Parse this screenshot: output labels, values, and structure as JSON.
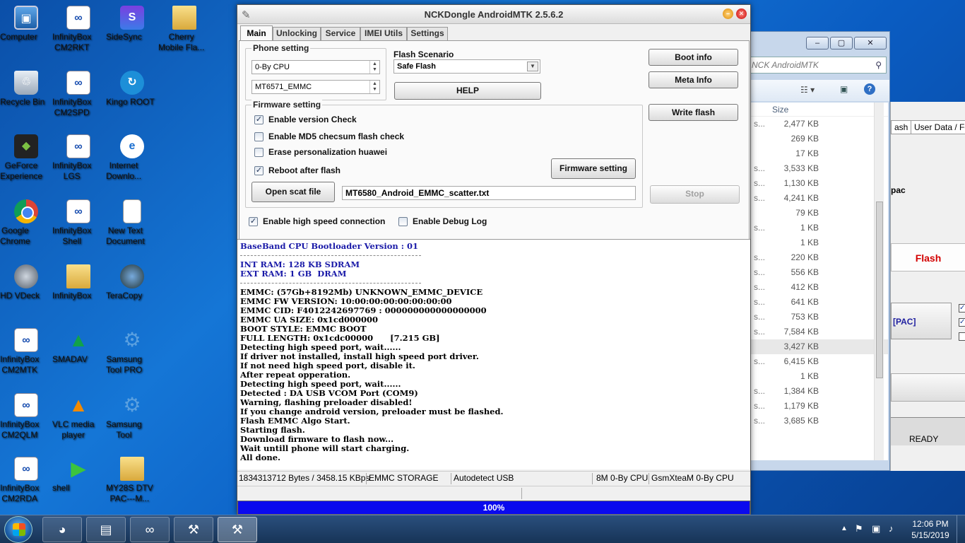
{
  "desktop": {
    "icons": [
      {
        "label": "Computer",
        "glyph": "▣",
        "cls": "computer"
      },
      {
        "label": "InfinityBox\nCM2RKT",
        "glyph": "∞",
        "cls": "infinity"
      },
      {
        "label": "SideSync",
        "glyph": "S",
        "cls": "sidesync"
      },
      {
        "label": "Cherry\nMobile Fla...",
        "glyph": "",
        "cls": "folder"
      },
      {
        "label": "Recycle Bin",
        "glyph": "♲",
        "cls": "recycle"
      },
      {
        "label": "InfinityBox\nCM2SPD",
        "glyph": "∞",
        "cls": "infinity"
      },
      {
        "label": "Kingo ROOT",
        "glyph": "↻",
        "cls": "kingo"
      },
      {
        "label": "GeForce\nExperience",
        "glyph": "◆",
        "cls": "geforce"
      },
      {
        "label": "InfinityBox\nLGS",
        "glyph": "∞",
        "cls": "infinity"
      },
      {
        "label": "Internet\nDownlo...",
        "glyph": "e",
        "cls": "ie"
      },
      {
        "label": "Google\nChrome",
        "glyph": "",
        "cls": "chrome"
      },
      {
        "label": "InfinityBox\nShell",
        "glyph": "∞",
        "cls": "infinity"
      },
      {
        "label": "New Text\nDocument",
        "glyph": "≡",
        "cls": "doc"
      },
      {
        "label": "HD VDeck",
        "glyph": "",
        "cls": "hdv"
      },
      {
        "label": "InfinityBox",
        "glyph": "",
        "cls": "folder"
      },
      {
        "label": "TeraCopy",
        "glyph": "",
        "cls": "tera"
      },
      {
        "label": "InfinityBox\nCM2MTK",
        "glyph": "∞",
        "cls": "infinity"
      },
      {
        "label": "SMADAV",
        "glyph": "▲",
        "cls": "smad"
      },
      {
        "label": "Samsung\nTool PRO",
        "glyph": "⚙",
        "cls": "gear"
      },
      {
        "label": "InfinityBox\nCM2QLM",
        "glyph": "∞",
        "cls": "infinity"
      },
      {
        "label": "VLC media\nplayer",
        "glyph": "▲",
        "cls": "vlc"
      },
      {
        "label": "Samsung\nTool",
        "glyph": "⚙",
        "cls": "gear"
      },
      {
        "label": "InfinityBox\nCM2RDA",
        "glyph": "∞",
        "cls": "infinity"
      },
      {
        "label": "shell",
        "glyph": "▶",
        "cls": "shell"
      },
      {
        "label": "MY28S DTV\nPAC---M...",
        "glyph": "",
        "cls": "folder"
      }
    ]
  },
  "bg_window": {
    "search_placeholder": "NCK AndroidMTK",
    "size_header": "Size",
    "rows": [
      {
        "lead": "s...",
        "size": "2,477 KB"
      },
      {
        "lead": "",
        "size": "269 KB"
      },
      {
        "lead": "",
        "size": "17 KB"
      },
      {
        "lead": "s...",
        "size": "3,533 KB"
      },
      {
        "lead": "s...",
        "size": "1,130 KB"
      },
      {
        "lead": "s...",
        "size": "4,241 KB"
      },
      {
        "lead": "",
        "size": "79 KB"
      },
      {
        "lead": "s...",
        "size": "1 KB"
      },
      {
        "lead": "",
        "size": "1 KB"
      },
      {
        "lead": "s...",
        "size": "220 KB"
      },
      {
        "lead": "s...",
        "size": "556 KB"
      },
      {
        "lead": "s...",
        "size": "412 KB"
      },
      {
        "lead": "s...",
        "size": "641 KB"
      },
      {
        "lead": "s...",
        "size": "753 KB"
      },
      {
        "lead": "s...",
        "size": "7,584 KB"
      },
      {
        "lead": "",
        "size": "3,427 KB"
      },
      {
        "lead": "s...",
        "size": "6,415 KB"
      },
      {
        "lead": "",
        "size": "1 KB"
      },
      {
        "lead": "s...",
        "size": "1,384 KB"
      },
      {
        "lead": "s...",
        "size": "1,179 KB"
      },
      {
        "lead": "s...",
        "size": "3,685 KB"
      }
    ],
    "tab_flash": "ash",
    "tab_userdata": "User Data / For",
    "pac_label": "pac",
    "flash_label": "Flash",
    "pac_button": "[PAC]",
    "ready": "READY"
  },
  "app": {
    "title": "NCKDongle AndroidMTK 2.5.6.2",
    "tabs": [
      "Main",
      "Unlocking",
      "Service",
      "IMEI Utils",
      "Settings"
    ],
    "phone_setting": {
      "title": "Phone setting",
      "cpu": "0-By CPU",
      "chip": "MT6571_EMMC"
    },
    "flash_scenario": {
      "label": "Flash Scenario",
      "value": "Safe Flash"
    },
    "help": "HELP",
    "boot_info": "Boot info",
    "meta_info": "Meta Info",
    "write_flash": "Write flash",
    "stop": "Stop",
    "firmware": {
      "title": "Firmware setting",
      "enable_version_check": "Enable version Check",
      "enable_md5": "Enable MD5 checsum flash check",
      "erase_personalization": "Erase personalization huawei",
      "reboot_after_flash": "Reboot after flash",
      "firmware_setting_btn": "Firmware setting",
      "open_scat_file": "Open scat file",
      "scatter_path": "MT6580_Android_EMMC_scatter.txt"
    },
    "enable_high_speed": "Enable high speed connection",
    "enable_debug_log": "Enable Debug Log",
    "log": {
      "header": "BaseBand CPU Bootloader Version : 01",
      "ram": [
        "INT RAM: 128 KB SDRAM",
        "EXT RAM: 1 GB  DRAM"
      ],
      "lines": [
        "EMMC: (57Gb+8192Mb) UNKNOWN_EMMC_DEVICE",
        "EMMC FW VERSION: 10:00:00:00:00:00:00:00",
        "EMMC CID: F4012242697769 : 000000000000000000",
        "EMMC UA SIZE: 0x1cd000000",
        "BOOT STYLE: EMMC BOOT",
        "FULL LENGTH: 0x1cdc00000      [7.215 GB]",
        "Detecting high speed port, wait......",
        "If driver not installed, install high speed port driver.",
        "If not need high speed port, disable it.",
        "After repeat opperation.",
        "Detecting high speed port, wait......",
        "Detected : DA USB VCOM Port (COM9)",
        "Warning, flashing preloader disabled!",
        "If you change android version, preloader must be flashed.",
        "Flash EMMC Algo Start.",
        "Starting flash.",
        "Download firmware to flash now...",
        "Wait untill phone will start charging.",
        "All done."
      ]
    },
    "status": {
      "bytes": "1834313712 Bytes / 3458.15 KBps",
      "storage": "EMMC STORAGE",
      "usb": "Autodetect USB",
      "cpu": "8M 0-By CPU",
      "team": "GsmXteaM 0-By CPU"
    },
    "progress": {
      "value": 100,
      "label": "100%"
    }
  },
  "taskbar": {
    "items": [
      {
        "glyph": "◕",
        "name": "chrome-taskbar-icon"
      },
      {
        "glyph": "▤",
        "name": "explorer-taskbar-icon"
      },
      {
        "glyph": "∞",
        "name": "infinity-spd-taskbar-icon"
      },
      {
        "glyph": "⚒",
        "name": "nck-tool-taskbar-icon"
      },
      {
        "glyph": "⚒",
        "name": "nck-mtk-taskbar-icon"
      }
    ],
    "time": "12:06 PM",
    "date": "5/15/2019"
  }
}
